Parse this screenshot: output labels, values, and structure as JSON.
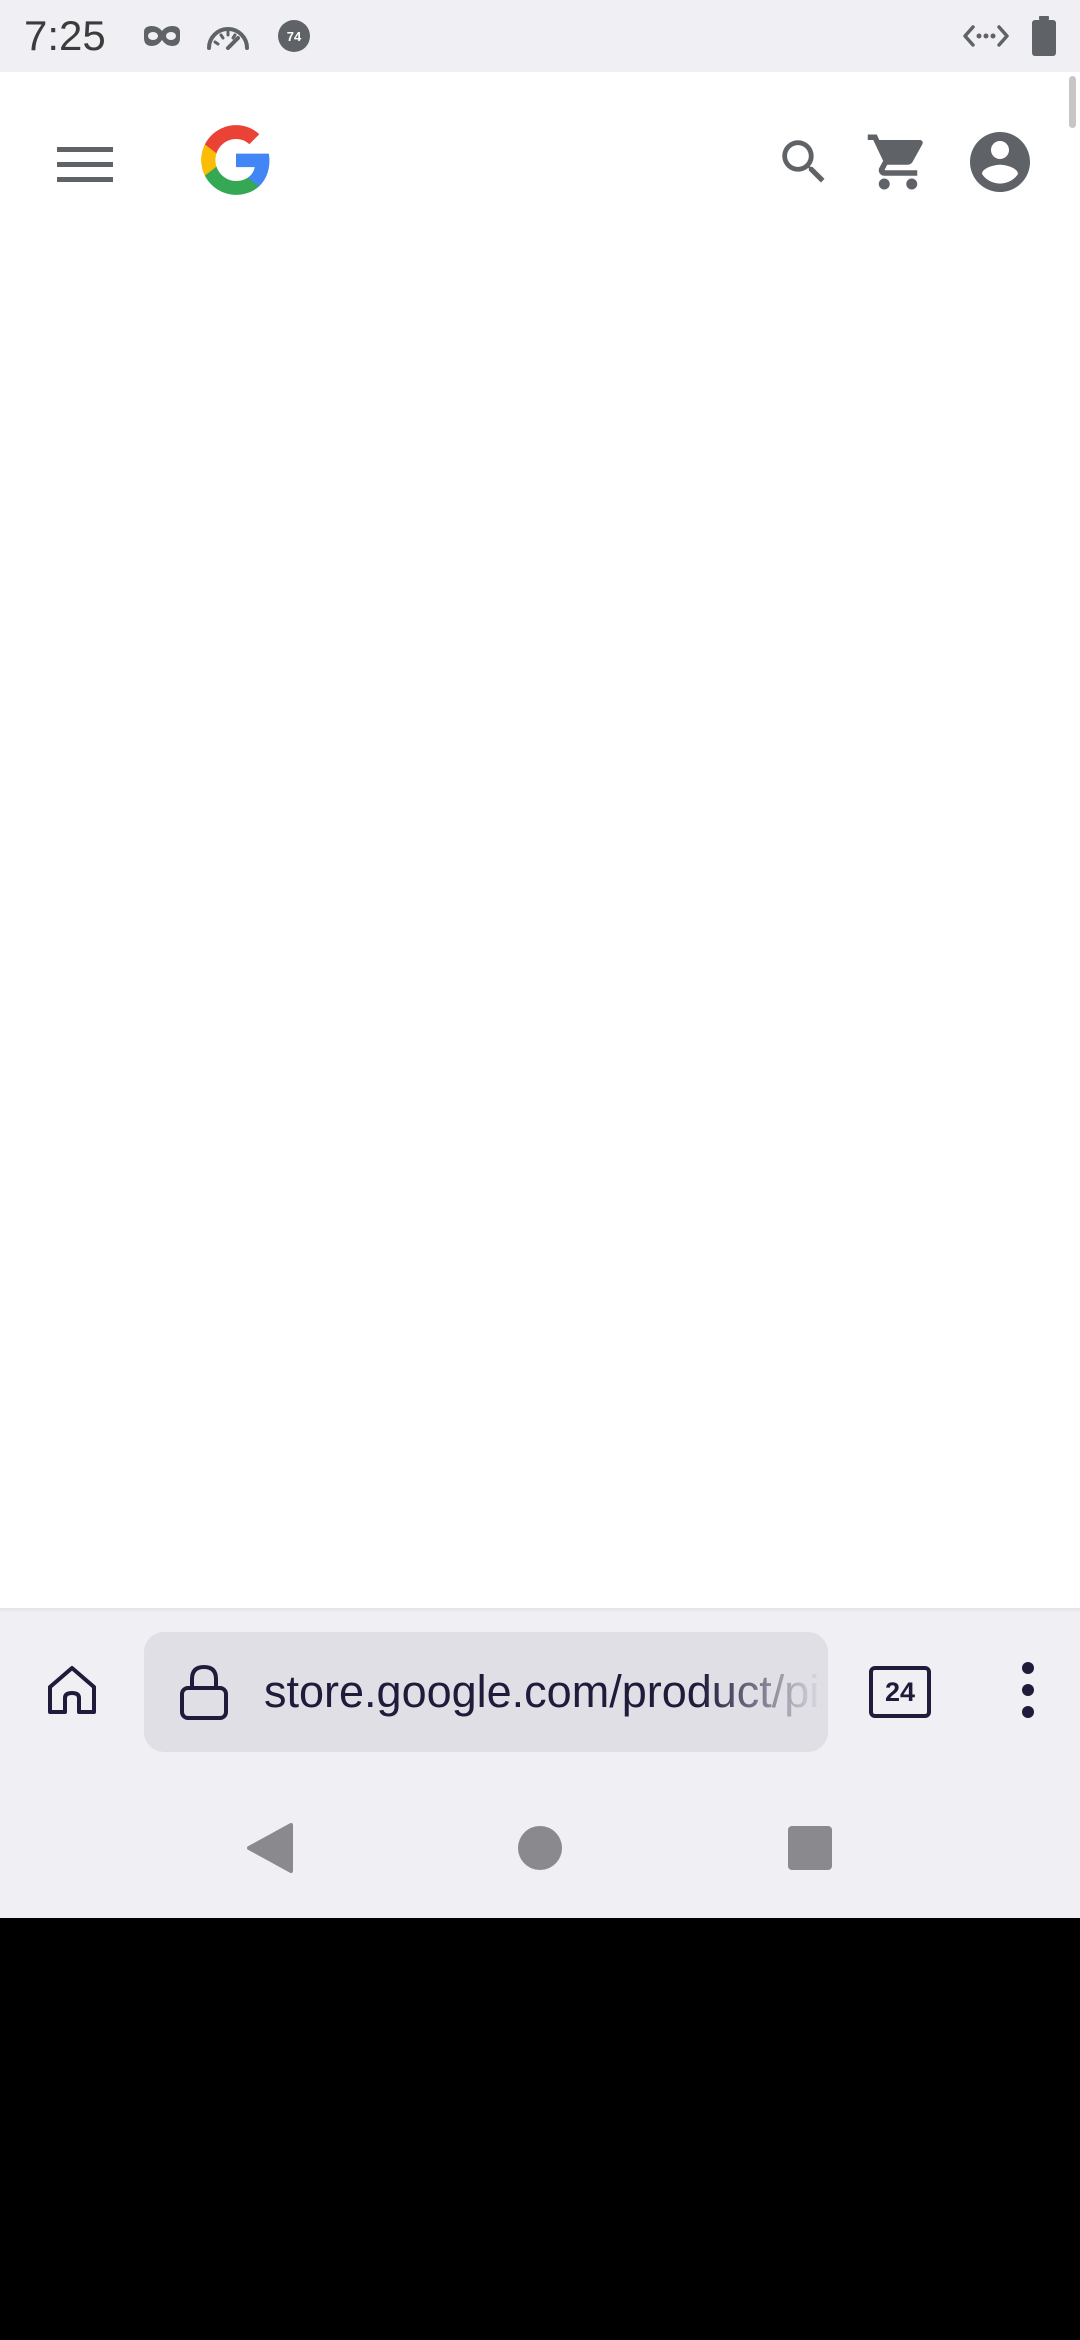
{
  "status_bar": {
    "time": "7:25",
    "left_icons": [
      "incognito-icon",
      "speedometer-icon",
      "notification-count-icon"
    ],
    "notification_badge": "74",
    "right_icons": [
      "code-arrows-icon",
      "battery-icon"
    ]
  },
  "site_header": {
    "icons": [
      "menu-icon",
      "google-logo",
      "search-icon",
      "cart-icon",
      "account-icon"
    ]
  },
  "browser_toolbar": {
    "url": "store.google.com/product/pixel",
    "tab_count": "24",
    "icons": [
      "home-icon",
      "lock-icon",
      "overflow-menu-icon"
    ]
  },
  "nav_bar": {
    "icons": [
      "back-icon",
      "home-circle-icon",
      "recents-icon"
    ]
  },
  "colors": {
    "status_bar_bg": "#efeff4",
    "page_bg": "#ffffff",
    "icon_gray": "#5f6368",
    "toolbar_bg": "#efeff4",
    "url_bar_bg": "#e0dfe6",
    "toolbar_ink": "#1f1b3a",
    "google_blue": "#4285f4",
    "google_red": "#ea4335",
    "google_yellow": "#fbbc05",
    "google_green": "#34a853"
  }
}
